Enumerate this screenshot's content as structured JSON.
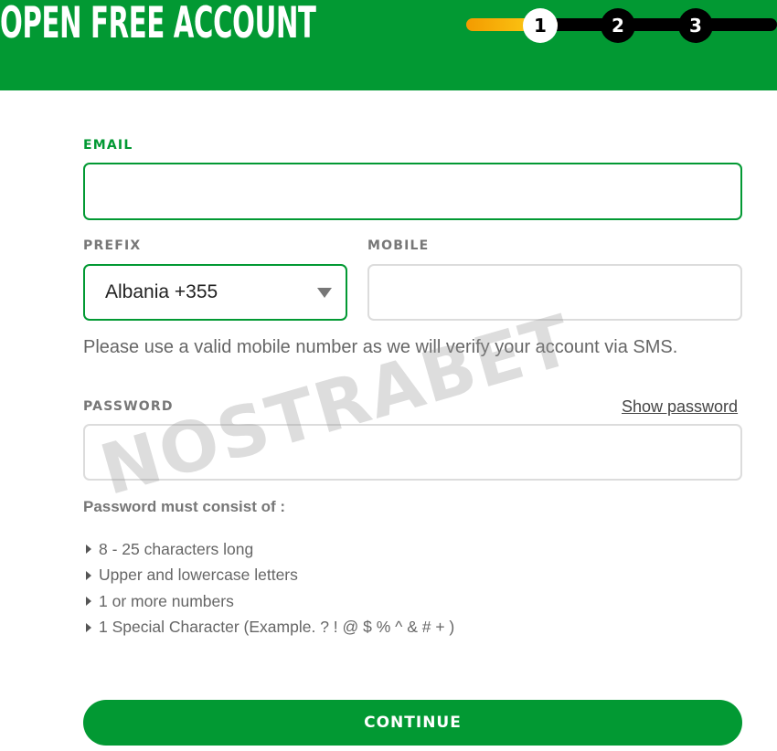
{
  "header": {
    "title": "OPEN FREE ACCOUNT",
    "steps": [
      "1",
      "2",
      "3"
    ],
    "active_step": 1,
    "brand_color": "#029933",
    "progress_fill": 0.3
  },
  "form": {
    "email_label": "EMAIL",
    "email_value": "",
    "prefix_label": "PREFIX",
    "prefix_value": "Albania +355",
    "mobile_label": "MOBILE",
    "mobile_value": "",
    "mobile_hint": "Please use a valid mobile number as we will verify your account via SMS.",
    "password_label": "PASSWORD",
    "password_value": "",
    "show_password": "Show password",
    "rules_title": "Password must consist of :",
    "rules": [
      "8 - 25 characters long",
      "Upper and lowercase letters",
      "1 or more numbers",
      "1 Special Character (Example. ? ! @ $ % ^ & # + )"
    ],
    "continue_label": "CONTINUE"
  },
  "watermark": "NOSTRABET",
  "icons": {
    "dropdown": "chevron-down-icon",
    "bullet": "triangle-right-icon"
  }
}
